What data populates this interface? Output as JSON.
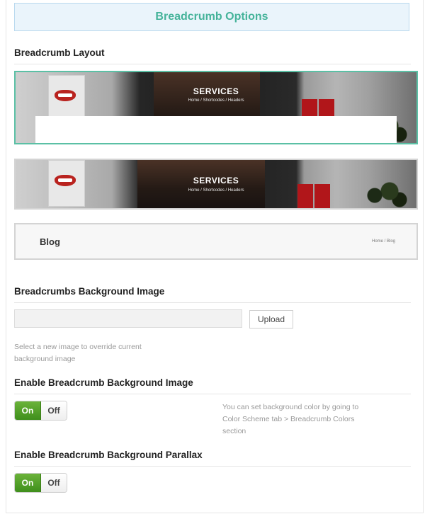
{
  "header": {
    "title": "Breadcrumb Options"
  },
  "sections": {
    "layout_title": "Breadcrumb Layout",
    "bg_image_title": "Breadcrumbs Background Image",
    "enable_bg_title": "Enable Breadcrumb Background Image",
    "enable_parallax_title": "Enable Breadcrumb Background Parallax"
  },
  "layouts": [
    {
      "title": "SERVICES",
      "crumbs": "Home  /  Shortcodes  /  Headers",
      "selected": true
    },
    {
      "title": "SERVICES",
      "crumbs": "Home  /  Shortcodes  /  Headers",
      "selected": false
    },
    {
      "title": "Blog",
      "crumbs": "Home  /  Blog",
      "selected": false
    }
  ],
  "upload": {
    "button_label": "Upload",
    "help_line1": "Select a new image to override current",
    "help_line2": "background image"
  },
  "enable_bg": {
    "on_label": "On",
    "off_label": "Off",
    "value": "On",
    "help_line1": "You can set background color by going to",
    "help_line2": "Color Scheme tab > Breadcrumb Colors",
    "help_line3": "section"
  },
  "enable_parallax": {
    "on_label": "On",
    "off_label": "Off",
    "value": "On"
  },
  "colors": {
    "accent": "#45b39a",
    "selected_border": "#5bc0a5",
    "toggle_on": "#4e9e26"
  }
}
